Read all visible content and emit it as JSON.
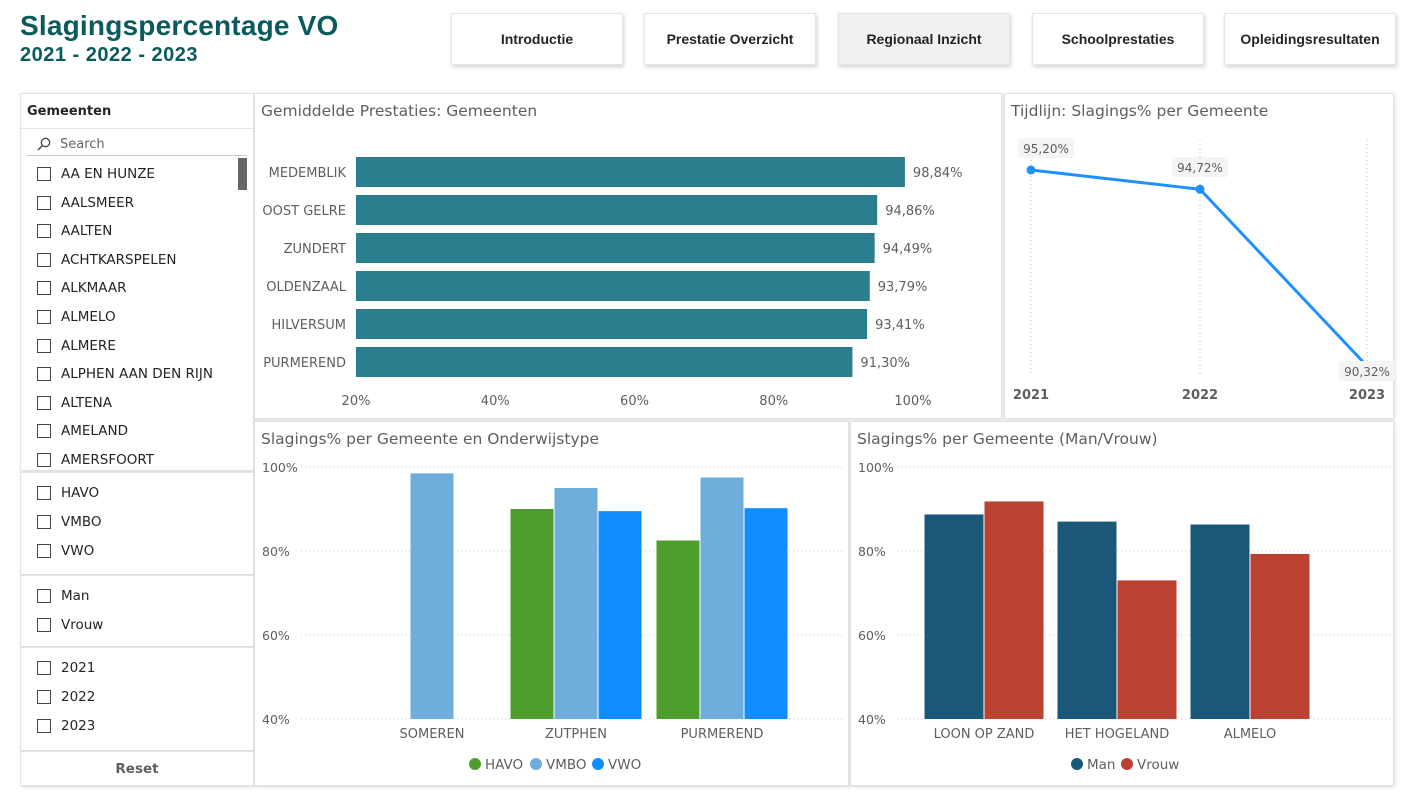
{
  "header": {
    "title": "Slagingspercentage VO",
    "subtitle": "2021 - 2022 - 2023"
  },
  "nav": [
    {
      "label": "Introductie",
      "active": false
    },
    {
      "label": "Prestatie Overzicht",
      "active": false
    },
    {
      "label": "Regionaal Inzicht",
      "active": true
    },
    {
      "label": "Schoolprestaties",
      "active": false
    },
    {
      "label": "Opleidingsresultaten",
      "active": false
    }
  ],
  "slicer": {
    "title": "Gemeenten",
    "search_placeholder": "Search",
    "gemeenten": [
      "AA EN HUNZE",
      "AALSMEER",
      "AALTEN",
      "ACHTKARSPELEN",
      "ALKMAAR",
      "ALMELO",
      "ALMERE",
      "ALPHEN AAN DEN RIJN",
      "ALTENA",
      "AMELAND",
      "AMERSFOORT"
    ],
    "onderwijstypes": [
      "HAVO",
      "VMBO",
      "VWO"
    ],
    "geslacht": [
      "Man",
      "Vrouw"
    ],
    "jaren": [
      "2021",
      "2022",
      "2023"
    ],
    "reset_label": "Reset"
  },
  "chart_titles": {
    "bar": "Gemiddelde Prestaties: Gemeenten",
    "line": "Tijdlijn: Slagings% per Gemeente",
    "edu": "Slagings% per Gemeente en Onderwijstype",
    "gender": "Slagings% per Gemeente (Man/Vrouw)"
  },
  "colors": {
    "teal": "#2a7e8d",
    "line": "#1e90ff",
    "havo": "#4e9e2f",
    "vmbo": "#6faddc",
    "vwo": "#118dff",
    "man": "#1a5778",
    "vrouw": "#bb4131"
  },
  "chart_data": [
    {
      "type": "bar",
      "orientation": "horizontal",
      "categories": [
        "MEDEMBLIK",
        "OOST GELRE",
        "ZUNDERT",
        "OLDENZAAL",
        "HILVERSUM",
        "PURMEREND"
      ],
      "values": [
        98.84,
        94.86,
        94.49,
        93.79,
        93.41,
        91.3
      ],
      "labels": [
        "98,84%",
        "94,86%",
        "94,49%",
        "93,79%",
        "93,41%",
        "91,30%"
      ],
      "xticks": [
        "20%",
        "40%",
        "60%",
        "80%",
        "100%"
      ],
      "xlim": [
        20,
        100
      ]
    },
    {
      "type": "line",
      "x": [
        "2021",
        "2022",
        "2023"
      ],
      "values": [
        95.2,
        94.72,
        90.32
      ],
      "labels": [
        "95,20%",
        "94,72%",
        "90,32%"
      ]
    },
    {
      "type": "bar",
      "categories": [
        "SOMEREN",
        "ZUTPHEN",
        "PURMEREND"
      ],
      "series": [
        {
          "name": "HAVO",
          "values": [
            null,
            90.0,
            82.5
          ]
        },
        {
          "name": "VMBO",
          "values": [
            98.5,
            95.0,
            97.5
          ]
        },
        {
          "name": "VWO",
          "values": [
            null,
            89.5,
            90.2
          ]
        }
      ],
      "yticks": [
        "100%",
        "80%",
        "60%",
        "40%"
      ],
      "ylim": [
        40,
        100
      ]
    },
    {
      "type": "bar",
      "categories": [
        "LOON OP ZAND",
        "HET HOGELAND",
        "ALMELO"
      ],
      "series": [
        {
          "name": "Man",
          "values": [
            88.7,
            87.0,
            86.3
          ]
        },
        {
          "name": "Vrouw",
          "values": [
            91.8,
            73.0,
            79.3
          ]
        }
      ],
      "yticks": [
        "100%",
        "80%",
        "60%",
        "40%"
      ],
      "ylim": [
        40,
        100
      ]
    }
  ]
}
